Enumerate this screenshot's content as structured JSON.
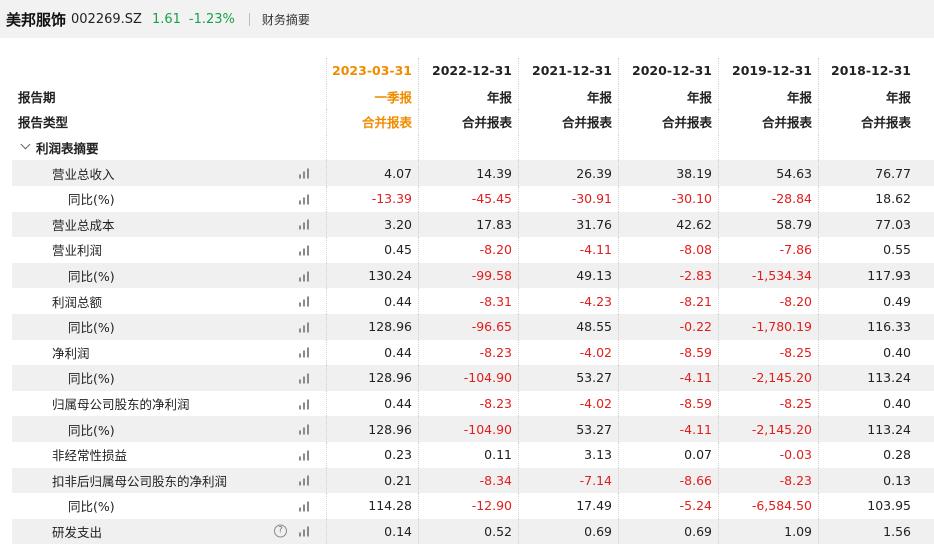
{
  "header": {
    "name": "美邦服饰",
    "code": "002269.SZ",
    "price": "1.61",
    "change": "-1.23%",
    "tab": "财务摘要"
  },
  "colors": {
    "up_green": "#16a34a",
    "negative_red": "#e01e1e",
    "current_period_orange": "#f08c00"
  },
  "header_rows": [
    {
      "label": "",
      "values": [
        "2023-03-31",
        "2022-12-31",
        "2021-12-31",
        "2020-12-31",
        "2019-12-31",
        "2018-12-31"
      ]
    },
    {
      "label": "报告期",
      "values": [
        "一季报",
        "年报",
        "年报",
        "年报",
        "年报",
        "年报"
      ]
    },
    {
      "label": "报告类型",
      "values": [
        "合并报表",
        "合并报表",
        "合并报表",
        "合并报表",
        "合并报表",
        "合并报表"
      ]
    }
  ],
  "section": {
    "label": "利润表摘要",
    "icon": "chevron-down-icon"
  },
  "rows": [
    {
      "label": "营业总收入",
      "level": 1,
      "values": [
        "4.07",
        "14.39",
        "26.39",
        "38.19",
        "54.63",
        "76.77"
      ]
    },
    {
      "label": "同比(%)",
      "level": 2,
      "values": [
        "-13.39",
        "-45.45",
        "-30.91",
        "-30.10",
        "-28.84",
        "18.62"
      ]
    },
    {
      "label": "营业总成本",
      "level": 1,
      "values": [
        "3.20",
        "17.83",
        "31.76",
        "42.62",
        "58.79",
        "77.03"
      ]
    },
    {
      "label": "营业利润",
      "level": 1,
      "values": [
        "0.45",
        "-8.20",
        "-4.11",
        "-8.08",
        "-7.86",
        "0.55"
      ]
    },
    {
      "label": "同比(%)",
      "level": 2,
      "values": [
        "130.24",
        "-99.58",
        "49.13",
        "-2.83",
        "-1,534.34",
        "117.93"
      ]
    },
    {
      "label": "利润总额",
      "level": 1,
      "values": [
        "0.44",
        "-8.31",
        "-4.23",
        "-8.21",
        "-8.20",
        "0.49"
      ]
    },
    {
      "label": "同比(%)",
      "level": 2,
      "values": [
        "128.96",
        "-96.65",
        "48.55",
        "-0.22",
        "-1,780.19",
        "116.33"
      ]
    },
    {
      "label": "净利润",
      "level": 1,
      "values": [
        "0.44",
        "-8.23",
        "-4.02",
        "-8.59",
        "-8.25",
        "0.40"
      ]
    },
    {
      "label": "同比(%)",
      "level": 2,
      "values": [
        "128.96",
        "-104.90",
        "53.27",
        "-4.11",
        "-2,145.20",
        "113.24"
      ]
    },
    {
      "label": "归属母公司股东的净利润",
      "level": 1,
      "values": [
        "0.44",
        "-8.23",
        "-4.02",
        "-8.59",
        "-8.25",
        "0.40"
      ]
    },
    {
      "label": "同比(%)",
      "level": 2,
      "values": [
        "128.96",
        "-104.90",
        "53.27",
        "-4.11",
        "-2,145.20",
        "113.24"
      ]
    },
    {
      "label": "非经常性损益",
      "level": 1,
      "values": [
        "0.23",
        "0.11",
        "3.13",
        "0.07",
        "-0.03",
        "0.28"
      ]
    },
    {
      "label": "扣非后归属母公司股东的净利润",
      "level": 1,
      "values": [
        "0.21",
        "-8.34",
        "-7.14",
        "-8.66",
        "-8.23",
        "0.13"
      ]
    },
    {
      "label": "同比(%)",
      "level": 2,
      "values": [
        "114.28",
        "-12.90",
        "17.49",
        "-5.24",
        "-6,584.50",
        "103.95"
      ]
    },
    {
      "label": "研发支出",
      "level": 1,
      "help": "?",
      "values": [
        "0.14",
        "0.52",
        "0.69",
        "0.69",
        "1.09",
        "1.56"
      ]
    }
  ]
}
